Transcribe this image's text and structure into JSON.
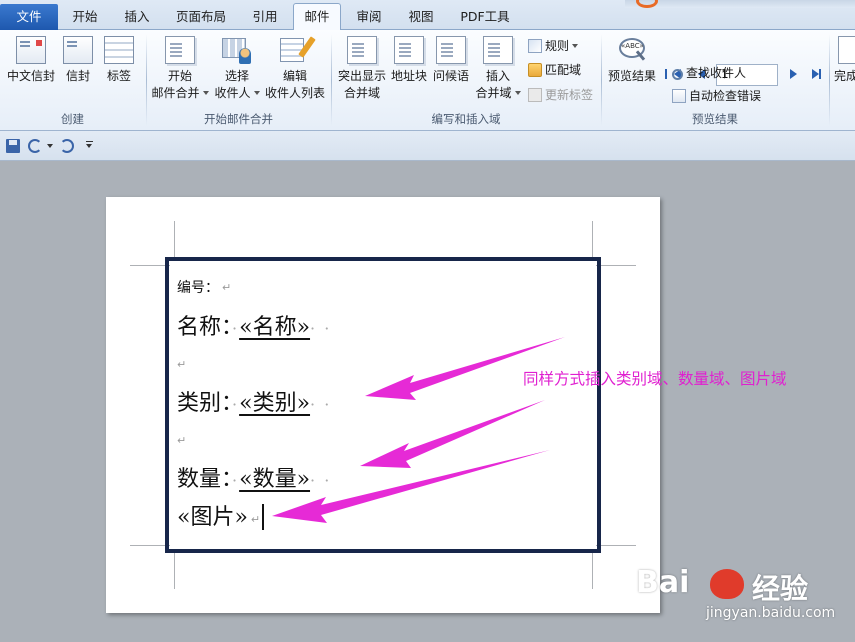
{
  "tabs": [
    {
      "label": "文件"
    },
    {
      "label": "开始"
    },
    {
      "label": "插入"
    },
    {
      "label": "页面布局"
    },
    {
      "label": "引用"
    },
    {
      "label": "邮件"
    },
    {
      "label": "审阅"
    },
    {
      "label": "视图"
    },
    {
      "label": "PDF工具"
    }
  ],
  "ribbon": {
    "create": {
      "label": "创建",
      "envelope_cn": "中文信封",
      "envelope": "信封",
      "labels": "标签"
    },
    "start_merge": {
      "label": "开始邮件合并",
      "start_line1": "开始",
      "start_line2": "邮件合并",
      "select_line1": "选择",
      "select_line2": "收件人",
      "edit_line1": "编辑",
      "edit_line2": "收件人列表"
    },
    "write_insert": {
      "label": "编写和插入域",
      "highlight_line1": "突出显示",
      "highlight_line2": "合并域",
      "address": "地址块",
      "greeting": "问候语",
      "insert_line1": "插入",
      "insert_line2": "合并域",
      "rules": "规则",
      "match": "匹配域",
      "update": "更新标签"
    },
    "preview": {
      "label": "预览结果",
      "preview_btn": "预览结果",
      "record": "1",
      "find": "查找收件人",
      "check": "自动检查错误"
    },
    "finish": {
      "label": "完成"
    }
  },
  "document": {
    "number_label": "编号：",
    "name_label": "名称：",
    "name_field": "«名称»",
    "category_label": "类别：",
    "category_field": "«类别»",
    "quantity_label": "数量：",
    "quantity_field": "«数量»",
    "picture_field": "«图片»",
    "para_mark": "↵",
    "dots": "· ·",
    "lead_dot": "·"
  },
  "annotation": "同样方式插入类别域、数量域、图片域",
  "watermark": {
    "logo": "Bai",
    "cn": "经验",
    "url": "jingyan.baidu.com"
  },
  "colors": {
    "accent": "#e020d0",
    "frame": "#17264a",
    "tab_file": "#2a66c0"
  }
}
